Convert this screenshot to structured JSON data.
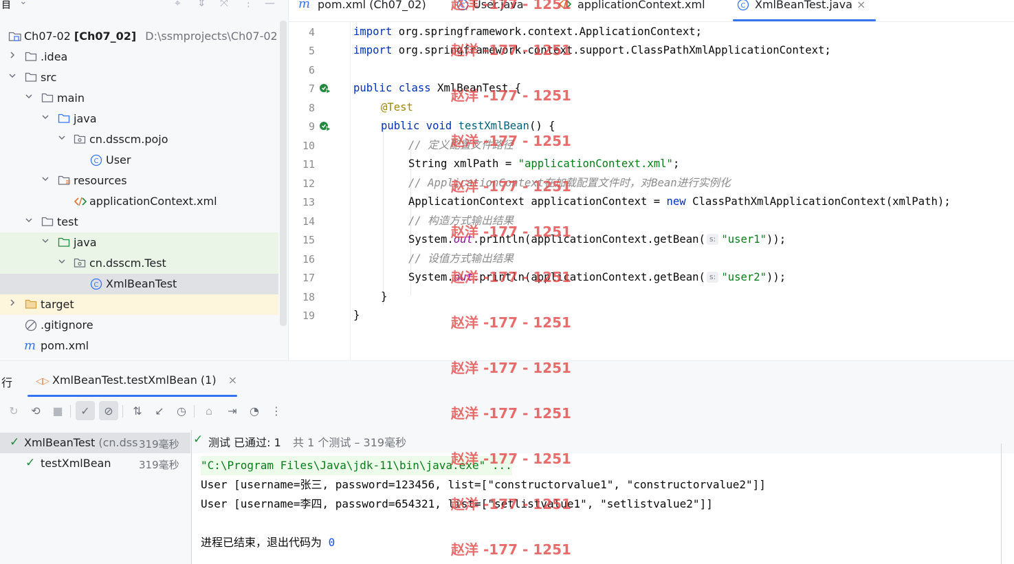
{
  "project_panel": {
    "title": "目",
    "root": {
      "name": "Ch07-02",
      "module": "[Ch07_02]",
      "path": "D:\\ssmprojects\\Ch07-02"
    },
    "items": [
      {
        "label": ".idea"
      },
      {
        "label": "src"
      },
      {
        "label": "main"
      },
      {
        "label": "java"
      },
      {
        "label": "cn.dsscm.pojo"
      },
      {
        "label": "User"
      },
      {
        "label": "resources"
      },
      {
        "label": "applicationContext.xml"
      },
      {
        "label": "test"
      },
      {
        "label": "java"
      },
      {
        "label": "cn.dsscm.Test"
      },
      {
        "label": "XmlBeanTest"
      },
      {
        "label": "target"
      },
      {
        "label": ".gitignore"
      },
      {
        "label": "pom.xml"
      }
    ]
  },
  "editor": {
    "tabs": [
      {
        "label": "pom.xml (Ch07_02)"
      },
      {
        "label": "User.java"
      },
      {
        "label": "applicationContext.xml"
      },
      {
        "label": "XmlBeanTest.java"
      }
    ],
    "close_glyph": "×",
    "line_numbers": [
      "4",
      "5",
      "6",
      "7",
      "8",
      "9",
      "10",
      "11",
      "12",
      "13",
      "14",
      "15",
      "16",
      "17",
      "18",
      "19"
    ],
    "code": {
      "l4_kw": "import",
      "l4_rest": " org.springframework.context.ApplicationContext;",
      "l5_kw": "import",
      "l5_rest": " org.springframework.context.support.ClassPathXmlApplicationContext;",
      "l7_kw": "public class",
      "l7_rest": " XmlBeanTest {",
      "l8_ann": "@Test",
      "l9_kw": "public void",
      "l9_fn": "testXmlBean",
      "l9_rest": "() {",
      "l10_cmt": "// 定义配置文件路径",
      "l11_pre": "String xmlPath = ",
      "l11_str": "\"applicationContext.xml\"",
      "l11_post": ";",
      "l12_cmt": "// ApplicationContext在加载配置文件时，对Bean进行实例化",
      "l13_pre": "ApplicationContext applicationContext = ",
      "l13_kw": "new",
      "l13_post": " ClassPathXmlApplicationContext(xmlPath);",
      "l14_cmt": "// 构造方式输出结果",
      "l15_pre": "System.",
      "l15_fld": "out",
      "l15_mid": ".println(applicationContext.getBean(",
      "l15_hint": "s:",
      "l15_str": "\"user1\"",
      "l15_post": "));",
      "l16_cmt": "// 设值方式输出结果",
      "l17_pre": "System.",
      "l17_fld": "out",
      "l17_mid": ".println(applicationContext.getBean(",
      "l17_hint": "s:",
      "l17_str": "\"user2\"",
      "l17_post": "));",
      "l18": "}",
      "l19": "}"
    }
  },
  "run_panel": {
    "title": "行",
    "tab_label": "XmlBeanTest.testXmlBean (1)",
    "close_glyph": "×",
    "test_tree": [
      {
        "name": "XmlBeanTest",
        "pkg": " (cn.dss",
        "time": "319毫秒"
      },
      {
        "name": "testXmlBean",
        "time": "319毫秒"
      }
    ],
    "status": {
      "passed": "测试 已通过: 1",
      "detail": "共 1 个测试 – 319毫秒"
    },
    "console": {
      "cmd": "\"C:\\Program Files\\Java\\jdk-11\\bin\\java.exe\" ...",
      "line1": "User [username=张三, password=123456, list=[\"constructorvalue1\", \"constructorvalue2\"]]",
      "line2": "User [username=李四, password=654321, list=[\"setlistvalue1\", \"setlistvalue2\"]]",
      "exit_text": "进程已结束，退出代码为 ",
      "exit_code": "0"
    }
  },
  "watermark": "赵洋 -177 - 1251",
  "colors": {
    "accent": "#3574f0",
    "keyword": "#0033b3",
    "string": "#067d17",
    "comment": "#8c8c8c",
    "annotation": "#9e880d",
    "pass_green": "#208a3c",
    "watermark": "#e24242"
  }
}
